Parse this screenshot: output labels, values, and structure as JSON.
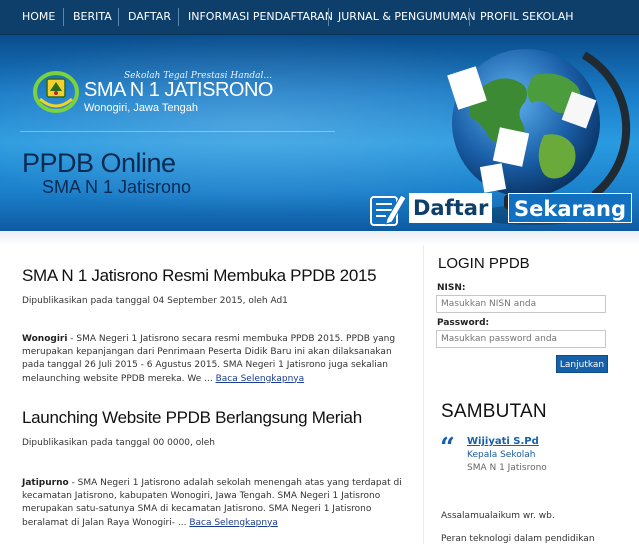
{
  "nav": {
    "items": [
      "HOME",
      "BERITA",
      "DAFTAR",
      "INFORMASI PENDAFTARAN",
      "JURNAL & PENGUMUMAN",
      "PROFIL SEKOLAH"
    ]
  },
  "header": {
    "motto": "Sekolah Tegal Prestasi Handal...",
    "school_name": "SMA N 1 JATISRONO",
    "location": "Wonogiri, Jawa Tengah",
    "ppdb_title": "PPDB Online",
    "ppdb_subtitle": "SMA N 1 Jatisrono",
    "daftar_word1": "Daftar",
    "daftar_word2": "Sekarang"
  },
  "articles": [
    {
      "title": "SMA N 1 Jatisrono Resmi Membuka PPDB 2015",
      "meta": "Dipublikasikan pada tanggal 04 September 2015, oleh Ad1",
      "lead": "Wonogiri",
      "body": " - SMA Negeri 1 Jatisrono secara resmi membuka PPDB 2015. PPDB yang merupakan kepanjangan dari Penrimaan Peserta Didik Baru ini akan dilaksanakan pada tanggal 26 Juli 2015 - 6 Agustus 2015. SMA Negeri 1 Jatisrono juga sekalian melaunching website PPDB mereka. We ... ",
      "more": "Baca Selengkapnya"
    },
    {
      "title": "Launching Website PPDB Berlangsung Meriah",
      "meta": "Dipublikasikan pada tanggal 00 0000, oleh",
      "lead": "Jatipurno",
      "body": " - SMA Negeri 1 Jatisrono adalah sekolah menengah atas yang terdapat di kecamatan Jatisrono, kabupaten Wonogiri, Jawa Tengah. SMA Negeri 1 Jatisrono merupakan satu-satunya SMA di kecamatan Jatisrono. SMA Negeri 1 Jatisrono beralamat di Jalan Raya Wonogiri- ... ",
      "more": "Baca Selengkapnya"
    }
  ],
  "login": {
    "title": "LOGIN PPDB",
    "nisn_label": "NISN:",
    "nisn_placeholder": "Masukkan NISN anda",
    "password_label": "Password:",
    "password_placeholder": "Masukkan password anda",
    "submit_label": "Lanjutkan"
  },
  "sambutan": {
    "title": "SAMBUTAN",
    "name": "Wijiyati S.Pd",
    "role": "Kepala Sekolah",
    "school": "SMA N 1 Jatisrono",
    "greeting": "Assalamualaikum wr. wb.",
    "intro": "Peran teknologi dalam pendidikan"
  },
  "colors": {
    "nav_bg": "#0e3f6b",
    "header_blue": "#2a9be0",
    "accent": "#1560a8"
  }
}
